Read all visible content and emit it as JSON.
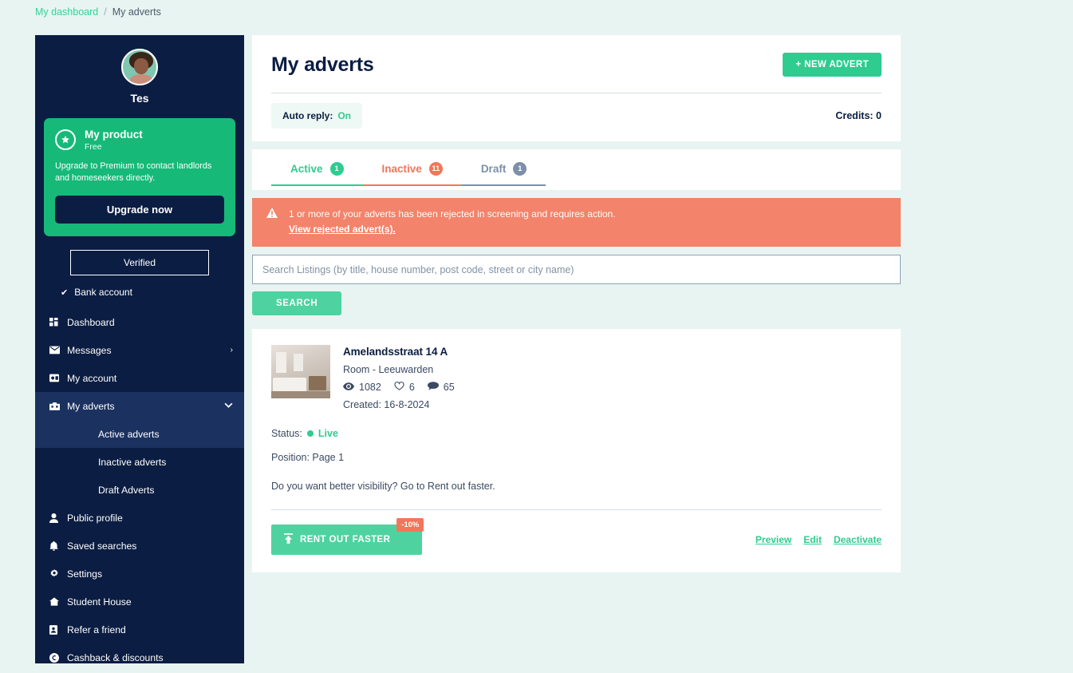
{
  "breadcrumb": {
    "home_label": "My dashboard",
    "separator": "/",
    "current_label": "My adverts"
  },
  "sidebar": {
    "user_name": "Tes",
    "avatar_icon": "user-avatar-photo",
    "product": {
      "icon": "star-circle-icon",
      "title": "My product",
      "plan": "Free",
      "description": "Upgrade to Premium to contact landlords and homeseekers directly.",
      "upgrade_label": "Upgrade now"
    },
    "verified_label": "Verified",
    "bank_account": {
      "check_icon": "check-icon",
      "label": "Bank account"
    },
    "items": [
      {
        "label": "Dashboard",
        "icon": "grid-icon",
        "arrow": ""
      },
      {
        "label": "Messages",
        "icon": "envelope-icon",
        "arrow": "›"
      },
      {
        "label": "My account",
        "icon": "id-card-icon",
        "arrow": ""
      },
      {
        "label": "My adverts",
        "icon": "building-icon",
        "arrow": "⌄"
      },
      {
        "label": "Public profile",
        "icon": "person-icon",
        "arrow": ""
      },
      {
        "label": "Saved searches",
        "icon": "bell-icon",
        "arrow": ""
      },
      {
        "label": "Settings",
        "icon": "gear-icon",
        "arrow": ""
      },
      {
        "label": "Student House",
        "icon": "home-icon",
        "arrow": ""
      },
      {
        "label": "Refer a friend",
        "icon": "contact-book-icon",
        "arrow": ""
      },
      {
        "label": "Cashback & discounts",
        "icon": "coin-icon",
        "arrow": ""
      }
    ],
    "sub_items": [
      {
        "label": "Active adverts"
      },
      {
        "label": "Inactive adverts"
      },
      {
        "label": "Draft Adverts"
      }
    ]
  },
  "header": {
    "title": "My adverts",
    "new_advert_label": "+ NEW ADVERT",
    "auto_reply_label": "Auto reply:",
    "auto_reply_value": "On",
    "credits_label": "Credits: 0"
  },
  "tabs": [
    {
      "label": "Active",
      "count": "1",
      "state": "active"
    },
    {
      "label": "Inactive",
      "count": "11",
      "state": "inactive"
    },
    {
      "label": "Draft",
      "count": "1",
      "state": "draft"
    }
  ],
  "alert": {
    "icon": "warning-triangle-icon",
    "message": "1 or more of your adverts has been rejected in screening and requires action.",
    "link_label": "View rejected advert(s)."
  },
  "search": {
    "placeholder": "Search Listings (by title, house number, post code, street or city name)",
    "value": "",
    "button_label": "SEARCH"
  },
  "listing": {
    "thumbnail_icon": "room-photo-thumbnail",
    "title": "Amelandsstraat 14 A",
    "subtitle": "Room - Leeuwarden",
    "stats": [
      {
        "icon": "eye-icon",
        "value": "1082"
      },
      {
        "icon": "heart-icon",
        "value": "6"
      },
      {
        "icon": "comment-icon",
        "value": "65"
      }
    ],
    "created": "Created: 16-8-2024",
    "status_label": "Status:",
    "status_value": "Live",
    "position": "Position: Page 1",
    "visibility_text": "Do you want better visibility? Go to Rent out faster.",
    "rent_button_label": "RENT OUT FASTER",
    "rent_button_icon": "upload-arrow-icon",
    "discount_badge": "-10%",
    "actions": [
      {
        "label": "Preview"
      },
      {
        "label": "Edit"
      },
      {
        "label": "Deactivate"
      }
    ]
  },
  "colors": {
    "brand_green": "#2ecc8f",
    "navy": "#0b1d42",
    "alert_orange": "#f3836a",
    "draft_gray": "#7d8fa9",
    "page_bg": "#e8f4f1"
  }
}
